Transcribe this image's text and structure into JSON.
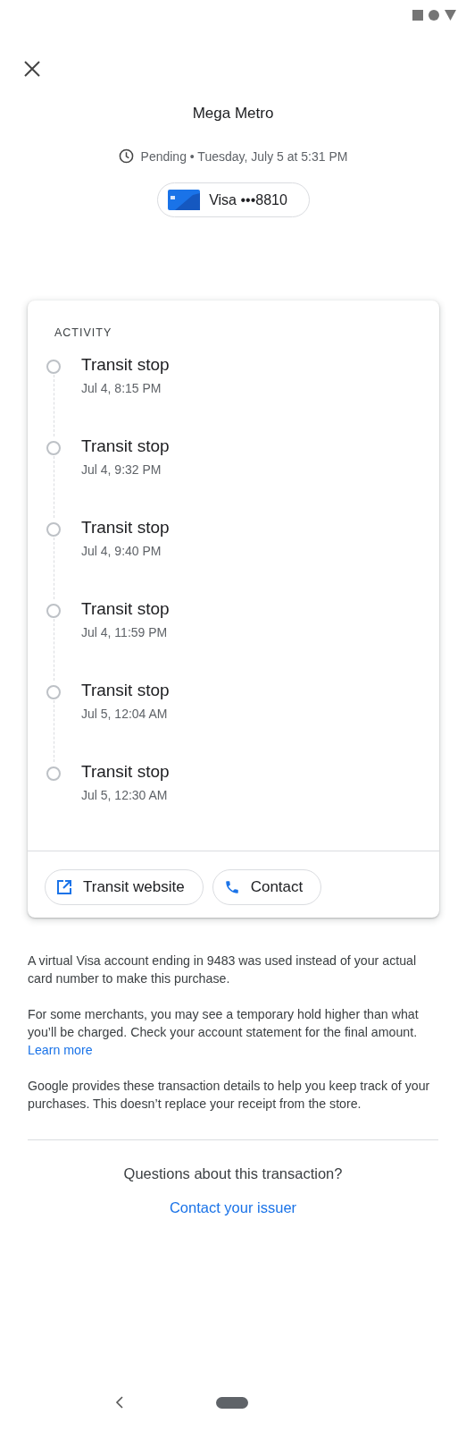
{
  "header": {
    "merchant": "Mega Metro",
    "status": "Pending • Tuesday, July 5 at 5:31 PM",
    "card": "Visa •••8810"
  },
  "activity": {
    "title": "ACTIVITY",
    "items": [
      {
        "title": "Transit stop",
        "time": "Jul 4, 8:15 PM"
      },
      {
        "title": "Transit stop",
        "time": "Jul 4, 9:32 PM"
      },
      {
        "title": "Transit stop",
        "time": "Jul 4, 9:40 PM"
      },
      {
        "title": "Transit stop",
        "time": "Jul 4, 11:59 PM"
      },
      {
        "title": "Transit stop",
        "time": "Jul 5, 12:04 AM"
      },
      {
        "title": "Transit stop",
        "time": "Jul 5, 12:30 AM"
      }
    ],
    "actions": [
      {
        "kind": "website",
        "label": "Transit website"
      },
      {
        "kind": "phone",
        "label": "Contact"
      }
    ]
  },
  "notes": [
    {
      "text": "A virtual Visa account ending in 9483 was used instead of your actual card number to make this purchase."
    },
    {
      "text": "For some merchants, you may see a temporary hold higher than what you’ll be charged. Check your account statement for the final amount.",
      "link": "Learn more"
    },
    {
      "text": "Google provides these transaction details to help you keep track of your purchases. This doesn’t replace your receipt from the store."
    }
  ],
  "footer": {
    "question": "Questions about this transaction?",
    "link": "Contact your issuer"
  }
}
